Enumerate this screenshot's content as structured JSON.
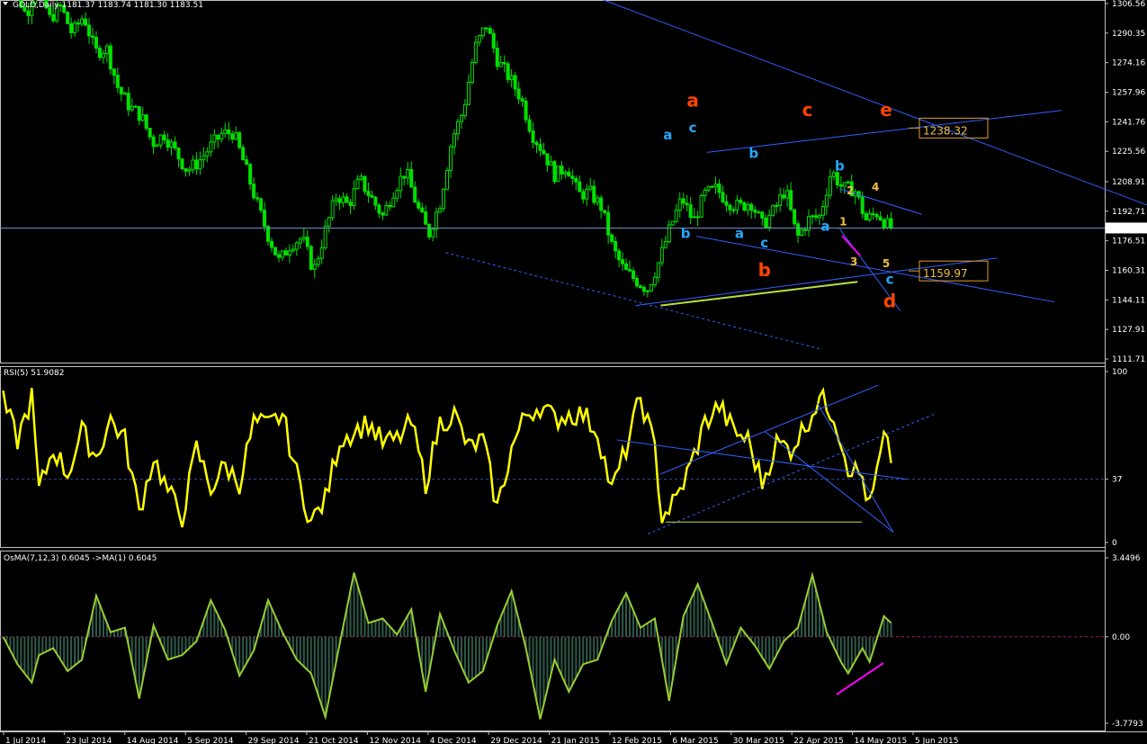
{
  "colors": {
    "background": "#000000",
    "candle": "#00e000",
    "rsi": "#ffff00",
    "osma_hist": "#2f5a4a",
    "osma_line": "#9acd32",
    "channel": "#3060ff",
    "wave_orange": "#ff4400",
    "wave_cyan": "#22aaff",
    "wave_num": "#f0c040",
    "support_line": "#b8e040",
    "divergence": "#ff00ff",
    "price_box": "#e0a030"
  },
  "chart_data": [
    {
      "type": "candlestick",
      "title": "GOLD,Daily  1181.37 1183.74 1181.30 1183.51",
      "current_price": "1183.51",
      "ylim": [
        1111.71,
        1306.56
      ],
      "y_ticks": [
        "1306.56",
        "1290.35",
        "1274.16",
        "1257.96",
        "1241.76",
        "1225.56",
        "1208.91",
        "1192.71",
        "1176.51",
        "1160.31",
        "1144.11",
        "1127.91",
        "1111.71"
      ],
      "x_ticks": [
        "1 Jul 2014",
        "23 Jul 2014",
        "14 Aug 2014",
        "5 Sep 2014",
        "29 Sep 2014",
        "21 Oct 2014",
        "12 Nov 2014",
        "4 Dec 2014",
        "29 Dec 2014",
        "21 Jan 2015",
        "12 Feb 2015",
        "6 Mar 2015",
        "30 Mar 2015",
        "22 Apr 2015",
        "14 May 2015",
        "5 Jun 2015"
      ],
      "close_path": [
        [
          0,
          1320
        ],
        [
          4,
          1315
        ],
        [
          8,
          1300
        ],
        [
          12,
          1320
        ],
        [
          16,
          1298
        ],
        [
          20,
          1305
        ],
        [
          24,
          1290
        ],
        [
          28,
          1300
        ],
        [
          32,
          1280
        ],
        [
          36,
          1282
        ],
        [
          40,
          1260
        ],
        [
          44,
          1250
        ],
        [
          48,
          1245
        ],
        [
          52,
          1230
        ],
        [
          56,
          1235
        ],
        [
          60,
          1225
        ],
        [
          64,
          1215
        ],
        [
          68,
          1220
        ],
        [
          72,
          1228
        ],
        [
          76,
          1235
        ],
        [
          80,
          1236
        ],
        [
          84,
          1218
        ],
        [
          88,
          1198
        ],
        [
          92,
          1180
        ],
        [
          96,
          1165
        ],
        [
          100,
          1175
        ],
        [
          104,
          1178
        ],
        [
          108,
          1160
        ],
        [
          112,
          1182
        ],
        [
          116,
          1202
        ],
        [
          120,
          1196
        ],
        [
          124,
          1210
        ],
        [
          128,
          1200
        ],
        [
          132,
          1190
        ],
        [
          136,
          1205
        ],
        [
          140,
          1215
        ],
        [
          144,
          1195
        ],
        [
          148,
          1180
        ],
        [
          152,
          1198
        ],
        [
          156,
          1232
        ],
        [
          160,
          1248
        ],
        [
          164,
          1282
        ],
        [
          168,
          1295
        ],
        [
          172,
          1275
        ],
        [
          176,
          1266
        ],
        [
          180,
          1255
        ],
        [
          184,
          1235
        ],
        [
          188,
          1225
        ],
        [
          192,
          1212
        ],
        [
          196,
          1218
        ],
        [
          200,
          1202
        ],
        [
          204,
          1203
        ],
        [
          208,
          1195
        ],
        [
          212,
          1172
        ],
        [
          216,
          1160
        ],
        [
          220,
          1155
        ],
        [
          224,
          1150
        ],
        [
          228,
          1165
        ],
        [
          232,
          1184
        ],
        [
          236,
          1200
        ],
        [
          240,
          1187
        ],
        [
          244,
          1202
        ],
        [
          248,
          1205
        ],
        [
          252,
          1198
        ],
        [
          256,
          1195
        ],
        [
          260,
          1198
        ],
        [
          264,
          1185
        ],
        [
          268,
          1193
        ],
        [
          272,
          1205
        ],
        [
          276,
          1178
        ],
        [
          280,
          1188
        ],
        [
          284,
          1190
        ],
        [
          288,
          1215
        ],
        [
          292,
          1205
        ],
        [
          296,
          1205
        ],
        [
          300,
          1188
        ],
        [
          304,
          1192
        ],
        [
          308,
          1184
        ],
        [
          310,
          1183.51
        ]
      ],
      "waves": [
        {
          "label": "a",
          "color": "orange",
          "i": 193,
          "price": 1250
        },
        {
          "label": "a",
          "color": "cyan",
          "i": 186,
          "price": 1232
        },
        {
          "label": "c",
          "color": "cyan",
          "i": 193,
          "price": 1236
        },
        {
          "label": "b",
          "color": "cyan",
          "i": 191,
          "price": 1178
        },
        {
          "label": "a",
          "color": "cyan",
          "i": 206,
          "price": 1178
        },
        {
          "label": "b",
          "color": "cyan",
          "i": 210,
          "price": 1222
        },
        {
          "label": "c",
          "color": "cyan",
          "i": 213,
          "price": 1173
        },
        {
          "label": "b",
          "color": "orange",
          "i": 213,
          "price": 1157
        },
        {
          "label": "c",
          "color": "orange",
          "i": 225,
          "price": 1245
        },
        {
          "label": "b",
          "color": "cyan",
          "i": 234,
          "price": 1215
        },
        {
          "label": "a",
          "color": "cyan",
          "i": 230,
          "price": 1182
        },
        {
          "label": "c",
          "color": "cyan",
          "i": 248,
          "price": 1153
        },
        {
          "label": "d",
          "color": "orange",
          "i": 248,
          "price": 1140
        },
        {
          "label": "e",
          "color": "orange",
          "i": 247,
          "price": 1245
        },
        {
          "label": "1",
          "color": "num",
          "i": 235,
          "price": 1185
        },
        {
          "label": "2",
          "color": "num",
          "i": 237,
          "price": 1202
        },
        {
          "label": "3",
          "color": "num",
          "i": 238,
          "price": 1163
        },
        {
          "label": "4",
          "color": "num",
          "i": 244,
          "price": 1204
        },
        {
          "label": "5",
          "color": "num",
          "i": 247,
          "price": 1162
        }
      ],
      "price_labels": [
        "1238.32",
        "1159.97"
      ]
    },
    {
      "type": "line",
      "title": "RSI(5) 51.9082",
      "ylim": [
        0,
        100
      ],
      "y_ticks": [
        "100",
        "37",
        "0"
      ],
      "level": 37,
      "values_path": [
        [
          0,
          82
        ],
        [
          4,
          60
        ],
        [
          8,
          85
        ],
        [
          10,
          30
        ],
        [
          14,
          55
        ],
        [
          18,
          40
        ],
        [
          22,
          65
        ],
        [
          26,
          50
        ],
        [
          30,
          72
        ],
        [
          34,
          60
        ],
        [
          38,
          18
        ],
        [
          42,
          50
        ],
        [
          46,
          30
        ],
        [
          50,
          15
        ],
        [
          54,
          55
        ],
        [
          58,
          32
        ],
        [
          62,
          45
        ],
        [
          66,
          35
        ],
        [
          70,
          70
        ],
        [
          74,
          68
        ],
        [
          78,
          75
        ],
        [
          82,
          40
        ],
        [
          86,
          12
        ],
        [
          90,
          25
        ],
        [
          94,
          60
        ],
        [
          98,
          65
        ],
        [
          102,
          70
        ],
        [
          106,
          58
        ],
        [
          110,
          60
        ],
        [
          114,
          70
        ],
        [
          118,
          35
        ],
        [
          122,
          70
        ],
        [
          126,
          75
        ],
        [
          130,
          55
        ],
        [
          134,
          60
        ],
        [
          138,
          20
        ],
        [
          142,
          55
        ],
        [
          146,
          75
        ],
        [
          150,
          80
        ],
        [
          154,
          72
        ],
        [
          158,
          75
        ],
        [
          162,
          75
        ],
        [
          166,
          65
        ],
        [
          170,
          30
        ],
        [
          174,
          55
        ],
        [
          178,
          85
        ],
        [
          182,
          55
        ],
        [
          184,
          15
        ],
        [
          188,
          25
        ],
        [
          192,
          45
        ],
        [
          196,
          70
        ],
        [
          200,
          80
        ],
        [
          204,
          65
        ],
        [
          208,
          60
        ],
        [
          212,
          35
        ],
        [
          216,
          58
        ],
        [
          220,
          55
        ],
        [
          224,
          68
        ],
        [
          228,
          85
        ],
        [
          232,
          75
        ],
        [
          236,
          45
        ],
        [
          240,
          38
        ],
        [
          242,
          20
        ],
        [
          246,
          60
        ],
        [
          248,
          50
        ]
      ]
    },
    {
      "type": "histogram",
      "title": "OsMA(7,12,3) 0.6045  ->MA(1) 0.6045",
      "ylim": [
        -3.7793,
        3.4496
      ],
      "y_ticks": [
        "3.4496",
        "0.00",
        "-3.7793"
      ],
      "values_path": [
        [
          0,
          0
        ],
        [
          4,
          -1.2
        ],
        [
          8,
          -2
        ],
        [
          10,
          -0.8
        ],
        [
          14,
          -0.5
        ],
        [
          18,
          -1.5
        ],
        [
          22,
          -1
        ],
        [
          26,
          1.8
        ],
        [
          30,
          0.2
        ],
        [
          34,
          0.4
        ],
        [
          38,
          -2.7
        ],
        [
          42,
          0.5
        ],
        [
          46,
          -1
        ],
        [
          50,
          -0.8
        ],
        [
          54,
          -0.2
        ],
        [
          58,
          1.6
        ],
        [
          62,
          0.3
        ],
        [
          66,
          -1.7
        ],
        [
          70,
          -0.6
        ],
        [
          74,
          1.6
        ],
        [
          78,
          0.2
        ],
        [
          82,
          -1
        ],
        [
          86,
          -1.6
        ],
        [
          90,
          -3.5
        ],
        [
          94,
          -0.3
        ],
        [
          98,
          2.8
        ],
        [
          102,
          0.6
        ],
        [
          106,
          0.8
        ],
        [
          110,
          0.1
        ],
        [
          114,
          1.2
        ],
        [
          118,
          -2.4
        ],
        [
          122,
          1
        ],
        [
          126,
          -0.6
        ],
        [
          130,
          -2
        ],
        [
          134,
          -1.5
        ],
        [
          138,
          0.5
        ],
        [
          142,
          2
        ],
        [
          146,
          -0.5
        ],
        [
          150,
          -3.6
        ],
        [
          154,
          -1
        ],
        [
          158,
          -2.4
        ],
        [
          162,
          -1.2
        ],
        [
          166,
          -1
        ],
        [
          170,
          0.7
        ],
        [
          174,
          1.9
        ],
        [
          178,
          0.4
        ],
        [
          182,
          0.8
        ],
        [
          186,
          -2.8
        ],
        [
          190,
          0.9
        ],
        [
          194,
          2.3
        ],
        [
          198,
          0.6
        ],
        [
          202,
          -1.2
        ],
        [
          206,
          0.4
        ],
        [
          210,
          -0.4
        ],
        [
          214,
          -1.4
        ],
        [
          218,
          -0.2
        ],
        [
          222,
          0.4
        ],
        [
          226,
          2.7
        ],
        [
          230,
          0.2
        ],
        [
          234,
          -1.1
        ],
        [
          236,
          -1.6
        ],
        [
          240,
          -0.5
        ],
        [
          242,
          -1.1
        ],
        [
          246,
          0.9
        ],
        [
          248,
          0.6
        ]
      ]
    }
  ]
}
